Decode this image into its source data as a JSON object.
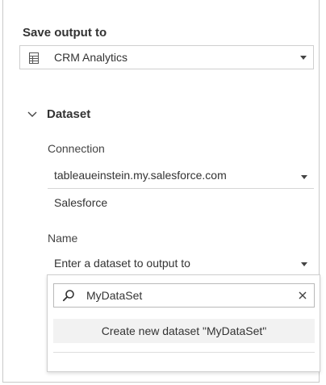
{
  "output": {
    "heading": "Save output to",
    "selected": "CRM Analytics"
  },
  "dataset": {
    "heading": "Dataset",
    "connection_label": "Connection",
    "connection_value": "tableaueinstein.my.salesforce.com",
    "connection_type": "Salesforce",
    "name_label": "Name",
    "name_placeholder": "Enter a dataset to output to"
  },
  "dropdown": {
    "search_value": "MyDataSet",
    "create_option": "Create new dataset \"MyDataSet\""
  },
  "colors": {
    "text": "#333333",
    "border": "#cfcfcf",
    "option_bg": "#f2f2f2",
    "spellcheck": "#d23a3a"
  }
}
